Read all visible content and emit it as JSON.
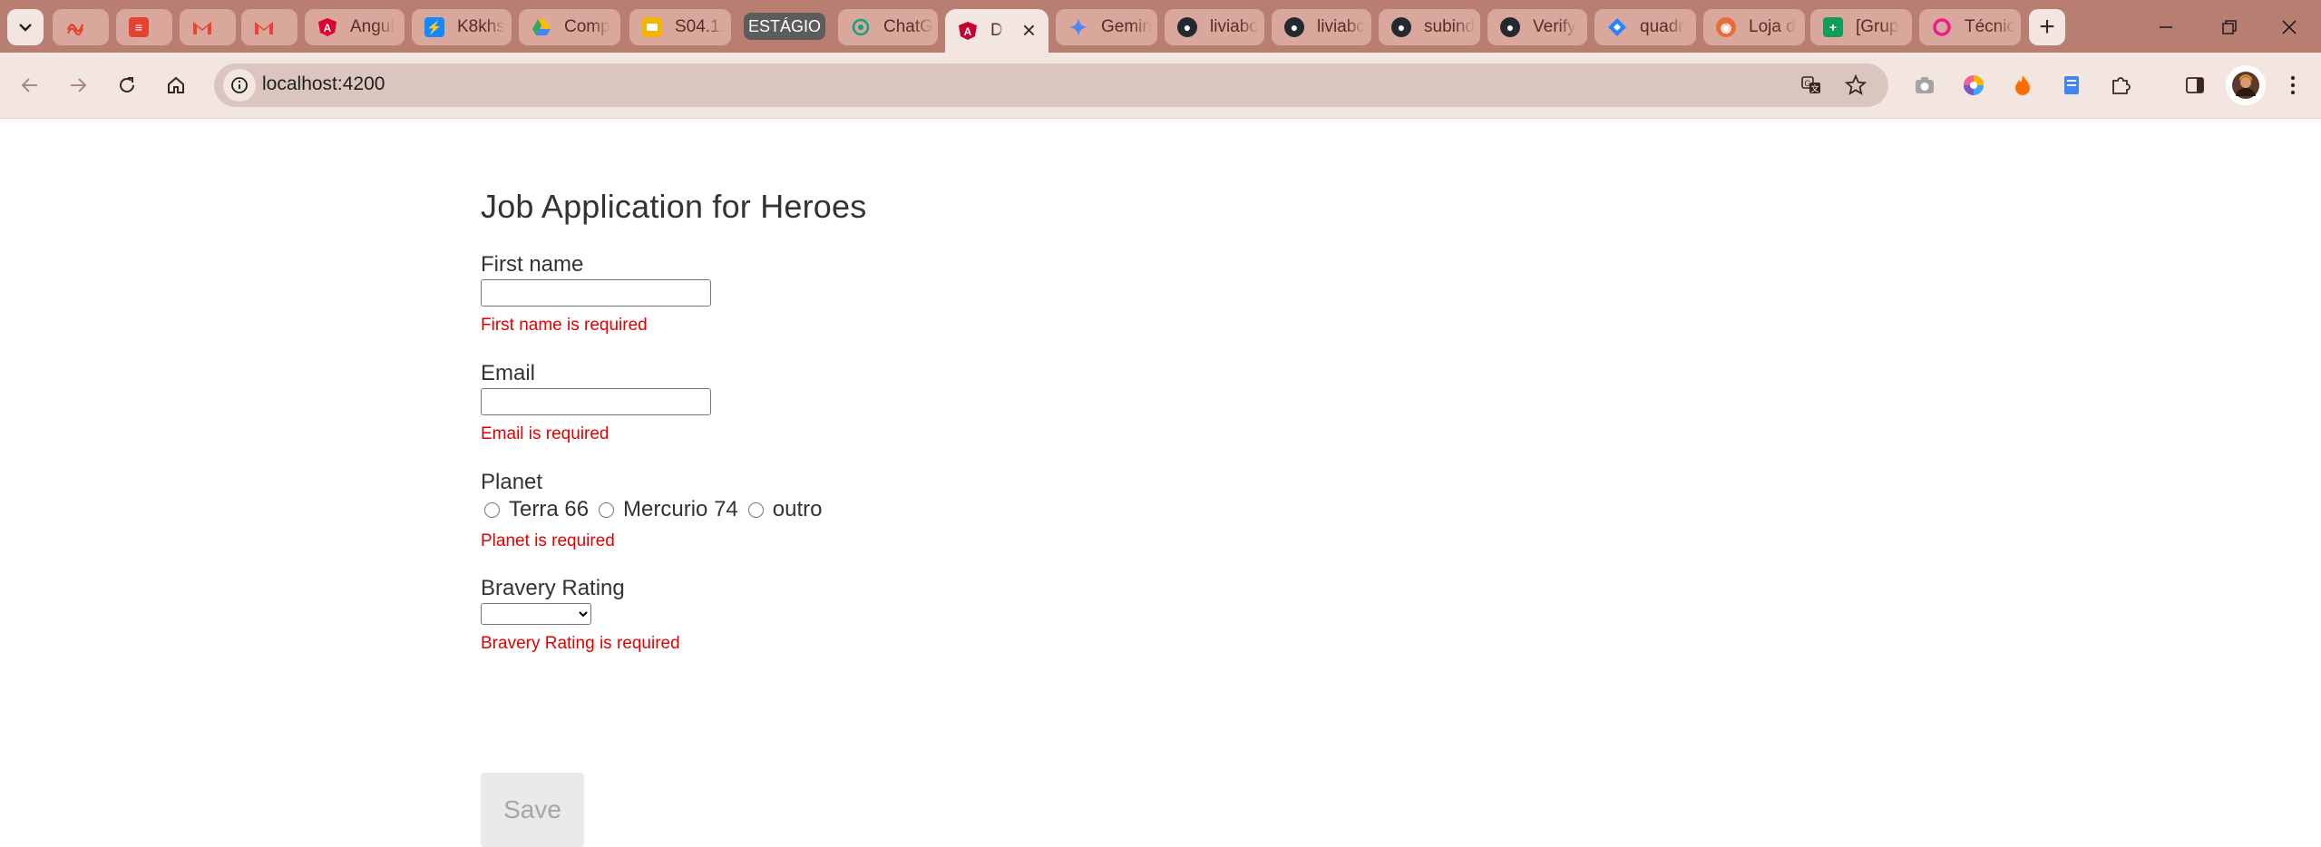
{
  "browser": {
    "tabs": [
      {
        "title": "",
        "icon": "todoist-squiggle-icon",
        "color": "#e44332"
      },
      {
        "title": "",
        "icon": "todoist-icon",
        "color": "#e44332"
      },
      {
        "title": "",
        "icon": "gmail-icon",
        "color": "#ea4335"
      },
      {
        "title": "",
        "icon": "gmail-icon",
        "color": "#ea4335"
      },
      {
        "title": "Angul",
        "icon": "angular-icon",
        "color": "#dd0031"
      },
      {
        "title": "K8khs",
        "icon": "bolt-icon",
        "color": "#1389fd"
      },
      {
        "title": "Comp",
        "icon": "google-drive-icon",
        "color": "#34a853"
      },
      {
        "title": "S04.1.",
        "icon": "google-slides-icon",
        "color": "#f4b400"
      },
      {
        "title": "ChatG",
        "icon": "chatgpt-icon",
        "color": "#10a37f"
      },
      {
        "title": "D",
        "icon": "angular-dev-icon",
        "color": "#c3002f"
      },
      {
        "title": "Gemin",
        "icon": "gemini-sparkle-icon",
        "color": "#4e86f2"
      },
      {
        "title": "liviabc",
        "icon": "github-icon",
        "color": "#24292f"
      },
      {
        "title": "liviabc",
        "icon": "github-icon",
        "color": "#24292f"
      },
      {
        "title": "subind",
        "icon": "github-icon",
        "color": "#24292f"
      },
      {
        "title": "Verify",
        "icon": "github-icon",
        "color": "#24292f"
      },
      {
        "title": "quadr",
        "icon": "jira-diamond-icon",
        "color": "#2684ff"
      },
      {
        "title": "Loja d",
        "icon": "store-icon",
        "color": "#e86c3a"
      },
      {
        "title": "[Grup",
        "icon": "google-sheets-icon",
        "color": "#0f9d58"
      },
      {
        "title": "Técnic",
        "icon": "circle-logo-icon",
        "color": "#e91e8c"
      }
    ],
    "tab_group_label": "ESTÁGIO",
    "address": "localhost:4200"
  },
  "form": {
    "title": "Job Application for Heroes",
    "first_name": {
      "label": "First name",
      "value": "",
      "error": "First name is required"
    },
    "email": {
      "label": "Email",
      "value": "",
      "error": "Email is required"
    },
    "planet": {
      "label": "Planet",
      "options": [
        "Terra 66",
        "Mercurio 74",
        "outro"
      ],
      "error": "Planet is required"
    },
    "bravery": {
      "label": "Bravery Rating",
      "selected": "",
      "error": "Bravery Rating is required"
    },
    "save_label": "Save"
  }
}
